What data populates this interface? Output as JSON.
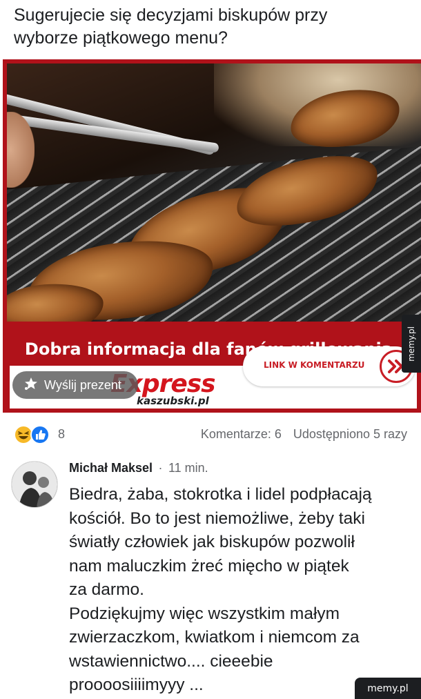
{
  "post": {
    "text": "Sugerujecie się decyzjami biskupów przy\nwyborze piątkowego menu?"
  },
  "image_card": {
    "headline": "Dobra informacja dla fanów grillowania.\nJest dyspensa na piątek!",
    "link_label": "LINK W KOMENTARZU",
    "brand_big": "Express",
    "brand_sub": "kaszubski.pl",
    "gift_label": "Wyślij prezent",
    "accent_color": "#b0121a"
  },
  "reactions": {
    "icons": [
      "haha-icon",
      "like-icon"
    ],
    "count": "8",
    "comments": "Komentarze: 6",
    "shares": "Udostępniono 5 razy"
  },
  "comment": {
    "author": "Michał Maksel",
    "separator": "·",
    "time": "11 min.",
    "body": "Biedra, żaba, stokrotka i lidel podpłacają\nkościół. Bo to jest niemożliwe, żeby taki\nświatły człowiek jak biskupów pozwolił\nnam maluczkim żreć mięcho w piątek\nza darmo.\nPodziękujmy więc wszystkim małym\nzwierzaczkom, kwiatkom i niemcom za\nwstawiennictwo.... cieeebie\nproooosiiiimyyy ..."
  },
  "watermark": {
    "side": "memy.pl",
    "bottom": "memy.pl"
  }
}
